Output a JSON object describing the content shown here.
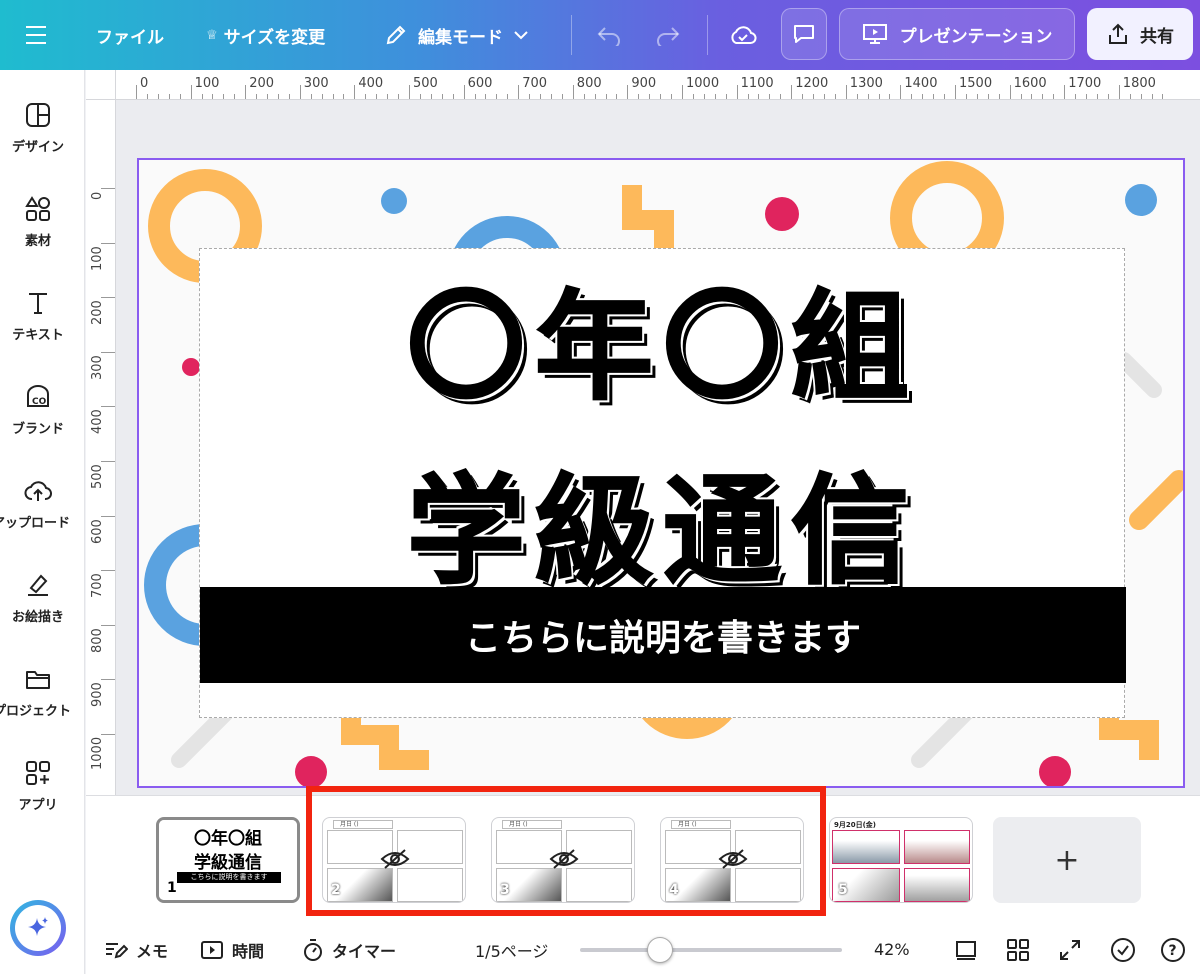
{
  "topbar": {
    "menu_icon": "hamburger-icon",
    "file_label": "ファイル",
    "resize_label": "サイズを変更",
    "edit_mode_label": "編集モード",
    "present_label": "プレゼンテーション",
    "share_label": "共有"
  },
  "ruler": {
    "top_labels": [
      "0",
      "100",
      "200",
      "300",
      "400",
      "500",
      "600",
      "700",
      "800",
      "900",
      "1000",
      "1100",
      "1200",
      "1300",
      "1400",
      "1500",
      "1600",
      "1700",
      "1800"
    ],
    "left_labels": [
      "0",
      "100",
      "200",
      "300",
      "400",
      "500",
      "600",
      "700",
      "800",
      "900",
      "1000"
    ]
  },
  "sidebar": {
    "items": [
      {
        "label": "デザイン",
        "icon": "design-icon"
      },
      {
        "label": "素材",
        "icon": "elements-icon"
      },
      {
        "label": "テキスト",
        "icon": "text-icon"
      },
      {
        "label": "ブランド",
        "icon": "brand-icon"
      },
      {
        "label": "アップロード",
        "icon": "upload-icon"
      },
      {
        "label": "お絵描き",
        "icon": "draw-icon"
      },
      {
        "label": "プロジェクト",
        "icon": "folder-icon"
      },
      {
        "label": "アプリ",
        "icon": "apps-icon"
      }
    ]
  },
  "canvas": {
    "title_line1": "〇年〇組",
    "title_line2": "学級通信",
    "description": "こちらに説明を書きます"
  },
  "filmstrip": {
    "pages": [
      {
        "number": "1",
        "line1": "〇年〇組",
        "line2": "学級通信",
        "desc": "こちらに説明を書きます",
        "hidden": false
      },
      {
        "number": "2",
        "header": "月日 ()",
        "hidden": true
      },
      {
        "number": "3",
        "header": "月日 ()",
        "hidden": true
      },
      {
        "number": "4",
        "header": "月日 ()",
        "hidden": true
      },
      {
        "number": "5",
        "header": "9月20日(金)",
        "hidden": false
      }
    ],
    "add_page_label": "+"
  },
  "bottombar": {
    "notes_label": "メモ",
    "timing_label": "時間",
    "timer_label": "タイマー",
    "page_indicator": "1/5ページ",
    "zoom_level": "42%",
    "zoom_fraction": 0.2
  },
  "colors": {
    "accent_purple": "#8a5cf0",
    "highlight_red": "#f2240f",
    "deco_orange": "#fdb95b",
    "deco_blue": "#5aa2e0",
    "deco_pink": "#e0245e"
  }
}
